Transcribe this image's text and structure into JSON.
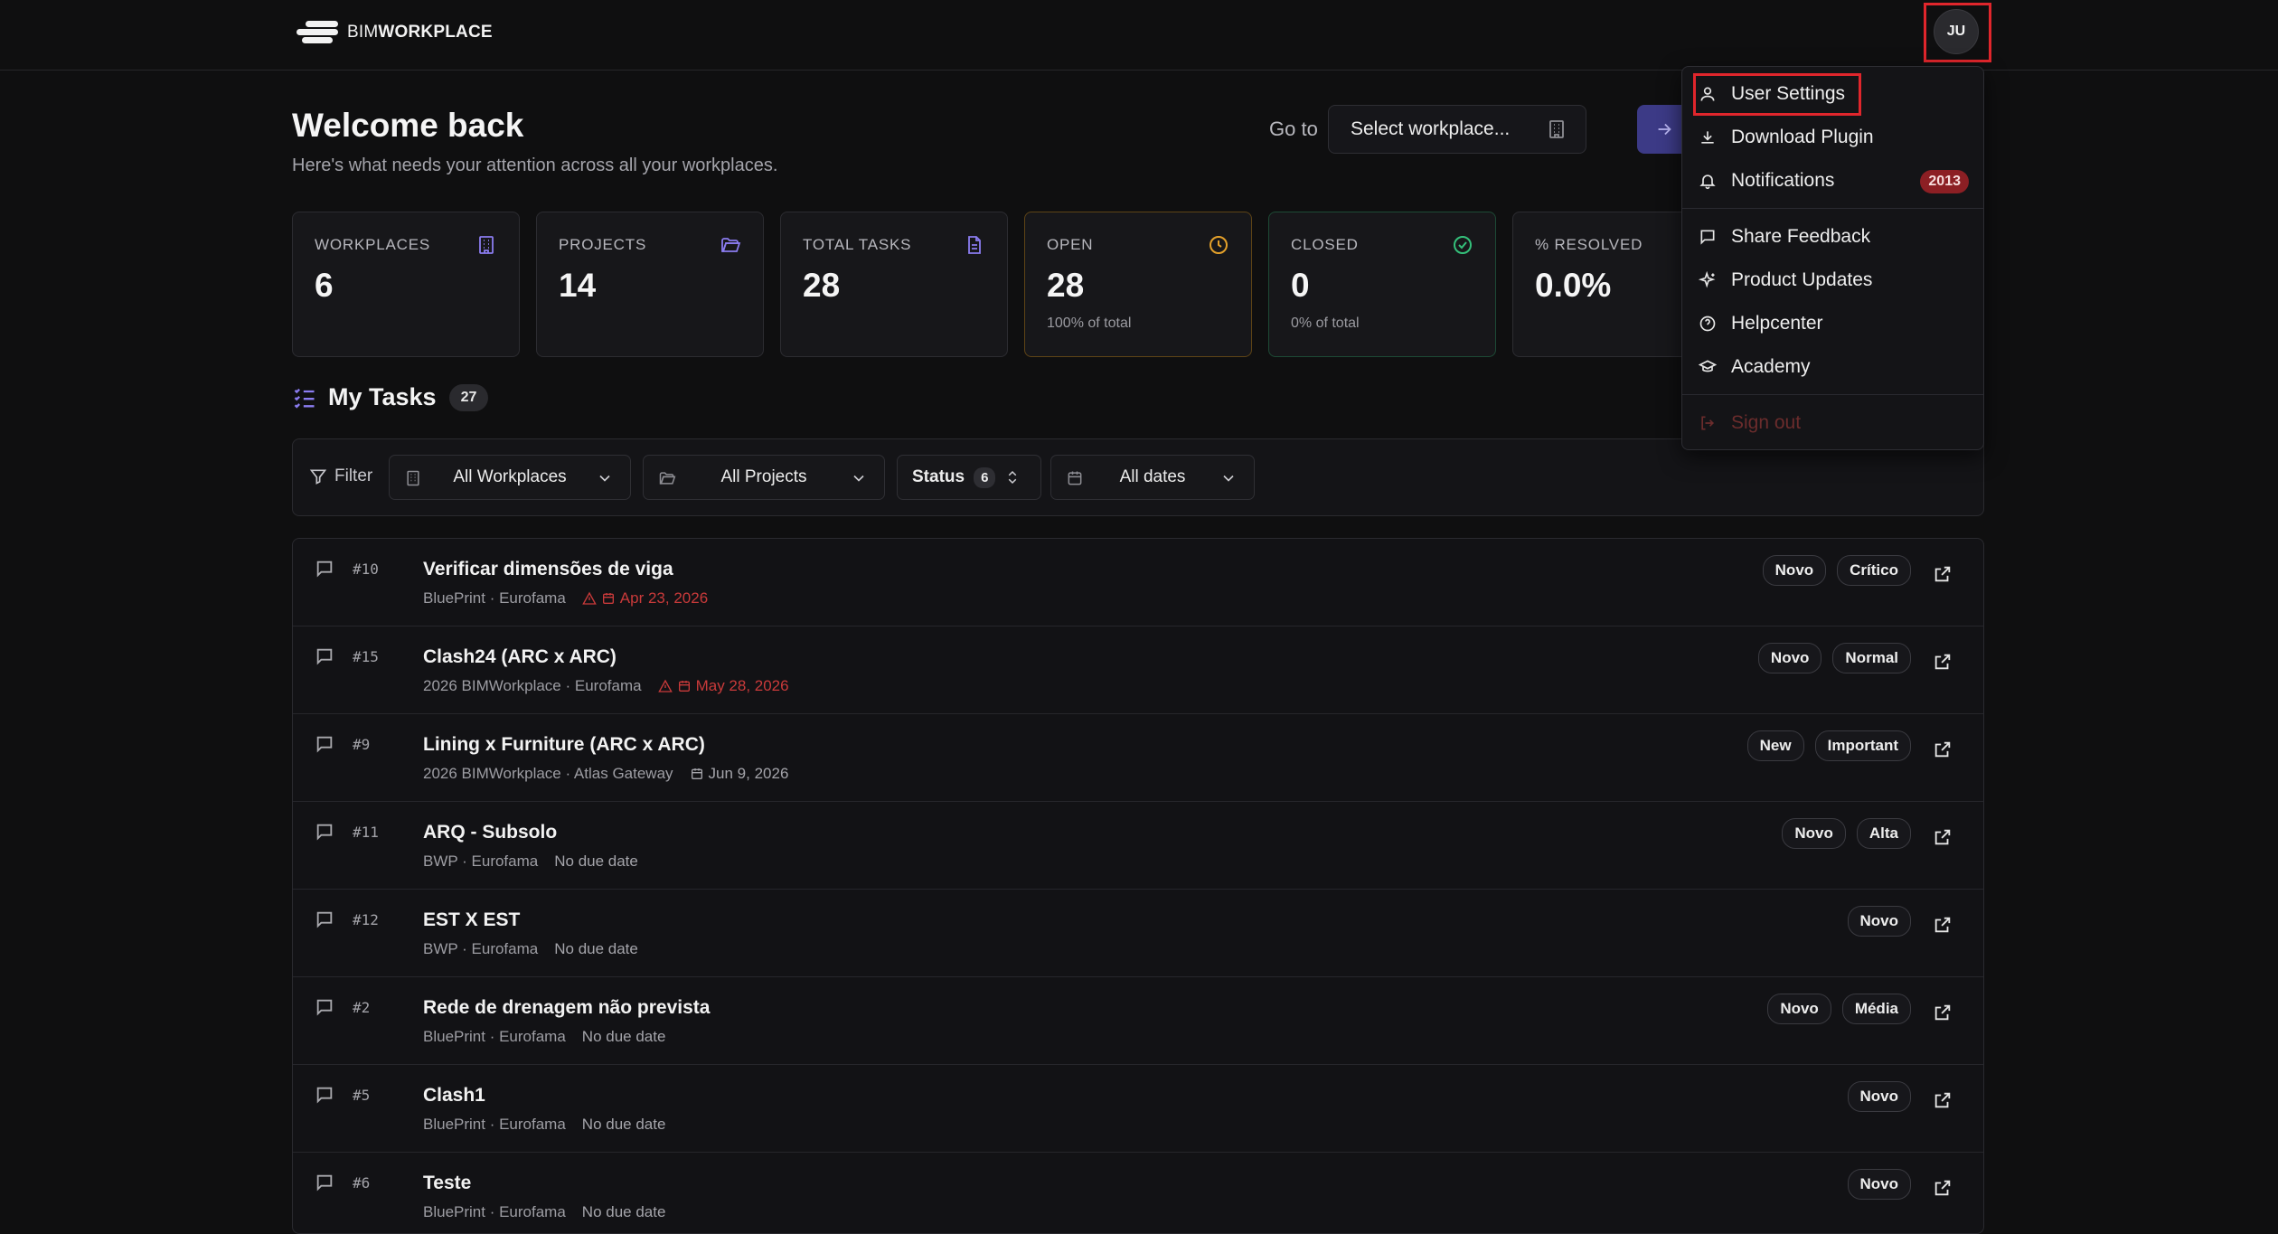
{
  "brand": {
    "light": "BIM",
    "bold": "WORKPLACE"
  },
  "user": {
    "initials": "JU"
  },
  "header": {
    "title": "Welcome back",
    "subtitle": "Here's what needs your attention across all your workplaces.",
    "goto_label": "Go to",
    "goto_placeholder": "Select workplace..."
  },
  "stats": [
    {
      "label": "WORKPLACES",
      "value": "6",
      "note": ""
    },
    {
      "label": "PROJECTS",
      "value": "14",
      "note": ""
    },
    {
      "label": "TOTAL TASKS",
      "value": "28",
      "note": ""
    },
    {
      "label": "OPEN",
      "value": "28",
      "note": "100% of total"
    },
    {
      "label": "CLOSED",
      "value": "0",
      "note": "0% of total"
    },
    {
      "label": "% RESOLVED",
      "value": "0.0%",
      "note": ""
    }
  ],
  "tasks_section": {
    "title": "My Tasks",
    "count": "27"
  },
  "filters": {
    "label": "Filter",
    "workplaces": "All Workplaces",
    "projects": "All Projects",
    "status_label": "Status",
    "status_count": "6",
    "dates": "All dates"
  },
  "tasks": [
    {
      "num": "#10",
      "title": "Verificar dimensões de viga",
      "meta": "BluePrint · Eurofama",
      "due": "Apr 23, 2026",
      "overdue": true,
      "badges": [
        "Novo",
        "Crítico"
      ]
    },
    {
      "num": "#15",
      "title": "Clash24 (ARC x ARC)",
      "meta": "2026 BIMWorkplace · Eurofama",
      "due": "May 28, 2026",
      "overdue": true,
      "badges": [
        "Novo",
        "Normal"
      ]
    },
    {
      "num": "#9",
      "title": "Lining x Furniture (ARC x ARC)",
      "meta": "2026 BIMWorkplace · Atlas Gateway",
      "due": "Jun 9, 2026",
      "overdue": false,
      "badges": [
        "New",
        "Important"
      ]
    },
    {
      "num": "#11",
      "title": "ARQ - Subsolo",
      "meta": "BWP · Eurofama",
      "due": "No due date",
      "overdue": null,
      "badges": [
        "Novo",
        "Alta"
      ]
    },
    {
      "num": "#12",
      "title": "EST X EST",
      "meta": "BWP · Eurofama",
      "due": "No due date",
      "overdue": null,
      "badges": [
        "Novo"
      ]
    },
    {
      "num": "#2",
      "title": "Rede de drenagem não prevista",
      "meta": "BluePrint · Eurofama",
      "due": "No due date",
      "overdue": null,
      "badges": [
        "Novo",
        "Média"
      ]
    },
    {
      "num": "#5",
      "title": "Clash1",
      "meta": "BluePrint · Eurofama",
      "due": "No due date",
      "overdue": null,
      "badges": [
        "Novo"
      ]
    },
    {
      "num": "#6",
      "title": "Teste",
      "meta": "BluePrint · Eurofama",
      "due": "No due date",
      "overdue": null,
      "badges": [
        "Novo"
      ]
    }
  ],
  "user_menu": {
    "user_settings": "User Settings",
    "download_plugin": "Download Plugin",
    "notifications": "Notifications",
    "notifications_count": "2013",
    "share_feedback": "Share Feedback",
    "product_updates": "Product Updates",
    "helpcenter": "Helpcenter",
    "academy": "Academy",
    "sign_out": "Sign out"
  },
  "colors": {
    "accent": "#3c3a86",
    "icon_purple": "#8b7cf0",
    "open_amber": "#e3a02a",
    "closed_green": "#34c07a",
    "overdue_red": "#c93a3a",
    "highlight_red": "#e0262c"
  }
}
